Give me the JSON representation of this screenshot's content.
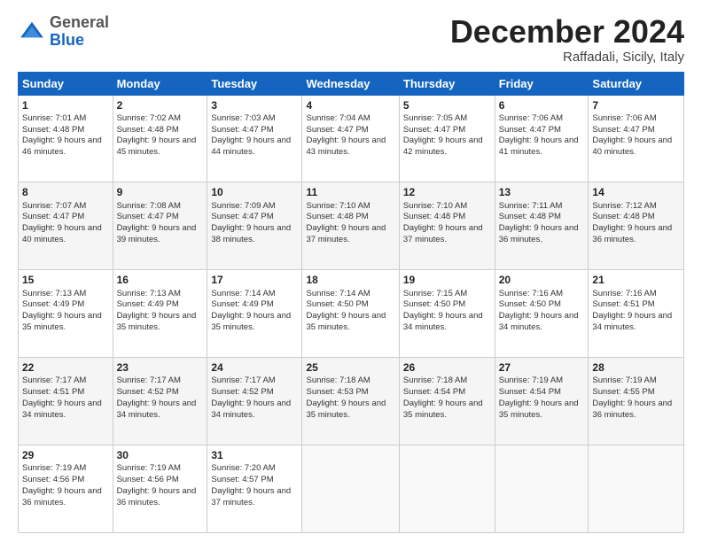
{
  "logo": {
    "general": "General",
    "blue": "Blue"
  },
  "header": {
    "month": "December 2024",
    "location": "Raffadali, Sicily, Italy"
  },
  "days": [
    "Sunday",
    "Monday",
    "Tuesday",
    "Wednesday",
    "Thursday",
    "Friday",
    "Saturday"
  ],
  "weeks": [
    [
      {
        "day": "1",
        "sunrise": "7:01 AM",
        "sunset": "4:48 PM",
        "daylight": "9 hours and 46 minutes."
      },
      {
        "day": "2",
        "sunrise": "7:02 AM",
        "sunset": "4:48 PM",
        "daylight": "9 hours and 45 minutes."
      },
      {
        "day": "3",
        "sunrise": "7:03 AM",
        "sunset": "4:47 PM",
        "daylight": "9 hours and 44 minutes."
      },
      {
        "day": "4",
        "sunrise": "7:04 AM",
        "sunset": "4:47 PM",
        "daylight": "9 hours and 43 minutes."
      },
      {
        "day": "5",
        "sunrise": "7:05 AM",
        "sunset": "4:47 PM",
        "daylight": "9 hours and 42 minutes."
      },
      {
        "day": "6",
        "sunrise": "7:06 AM",
        "sunset": "4:47 PM",
        "daylight": "9 hours and 41 minutes."
      },
      {
        "day": "7",
        "sunrise": "7:06 AM",
        "sunset": "4:47 PM",
        "daylight": "9 hours and 40 minutes."
      }
    ],
    [
      {
        "day": "8",
        "sunrise": "7:07 AM",
        "sunset": "4:47 PM",
        "daylight": "9 hours and 40 minutes."
      },
      {
        "day": "9",
        "sunrise": "7:08 AM",
        "sunset": "4:47 PM",
        "daylight": "9 hours and 39 minutes."
      },
      {
        "day": "10",
        "sunrise": "7:09 AM",
        "sunset": "4:47 PM",
        "daylight": "9 hours and 38 minutes."
      },
      {
        "day": "11",
        "sunrise": "7:10 AM",
        "sunset": "4:48 PM",
        "daylight": "9 hours and 37 minutes."
      },
      {
        "day": "12",
        "sunrise": "7:10 AM",
        "sunset": "4:48 PM",
        "daylight": "9 hours and 37 minutes."
      },
      {
        "day": "13",
        "sunrise": "7:11 AM",
        "sunset": "4:48 PM",
        "daylight": "9 hours and 36 minutes."
      },
      {
        "day": "14",
        "sunrise": "7:12 AM",
        "sunset": "4:48 PM",
        "daylight": "9 hours and 36 minutes."
      }
    ],
    [
      {
        "day": "15",
        "sunrise": "7:13 AM",
        "sunset": "4:49 PM",
        "daylight": "9 hours and 35 minutes."
      },
      {
        "day": "16",
        "sunrise": "7:13 AM",
        "sunset": "4:49 PM",
        "daylight": "9 hours and 35 minutes."
      },
      {
        "day": "17",
        "sunrise": "7:14 AM",
        "sunset": "4:49 PM",
        "daylight": "9 hours and 35 minutes."
      },
      {
        "day": "18",
        "sunrise": "7:14 AM",
        "sunset": "4:50 PM",
        "daylight": "9 hours and 35 minutes."
      },
      {
        "day": "19",
        "sunrise": "7:15 AM",
        "sunset": "4:50 PM",
        "daylight": "9 hours and 34 minutes."
      },
      {
        "day": "20",
        "sunrise": "7:16 AM",
        "sunset": "4:50 PM",
        "daylight": "9 hours and 34 minutes."
      },
      {
        "day": "21",
        "sunrise": "7:16 AM",
        "sunset": "4:51 PM",
        "daylight": "9 hours and 34 minutes."
      }
    ],
    [
      {
        "day": "22",
        "sunrise": "7:17 AM",
        "sunset": "4:51 PM",
        "daylight": "9 hours and 34 minutes."
      },
      {
        "day": "23",
        "sunrise": "7:17 AM",
        "sunset": "4:52 PM",
        "daylight": "9 hours and 34 minutes."
      },
      {
        "day": "24",
        "sunrise": "7:17 AM",
        "sunset": "4:52 PM",
        "daylight": "9 hours and 34 minutes."
      },
      {
        "day": "25",
        "sunrise": "7:18 AM",
        "sunset": "4:53 PM",
        "daylight": "9 hours and 35 minutes."
      },
      {
        "day": "26",
        "sunrise": "7:18 AM",
        "sunset": "4:54 PM",
        "daylight": "9 hours and 35 minutes."
      },
      {
        "day": "27",
        "sunrise": "7:19 AM",
        "sunset": "4:54 PM",
        "daylight": "9 hours and 35 minutes."
      },
      {
        "day": "28",
        "sunrise": "7:19 AM",
        "sunset": "4:55 PM",
        "daylight": "9 hours and 36 minutes."
      }
    ],
    [
      {
        "day": "29",
        "sunrise": "7:19 AM",
        "sunset": "4:56 PM",
        "daylight": "9 hours and 36 minutes."
      },
      {
        "day": "30",
        "sunrise": "7:19 AM",
        "sunset": "4:56 PM",
        "daylight": "9 hours and 36 minutes."
      },
      {
        "day": "31",
        "sunrise": "7:20 AM",
        "sunset": "4:57 PM",
        "daylight": "9 hours and 37 minutes."
      },
      null,
      null,
      null,
      null
    ]
  ],
  "labels": {
    "sunrise": "Sunrise:",
    "sunset": "Sunset:",
    "daylight": "Daylight:"
  }
}
